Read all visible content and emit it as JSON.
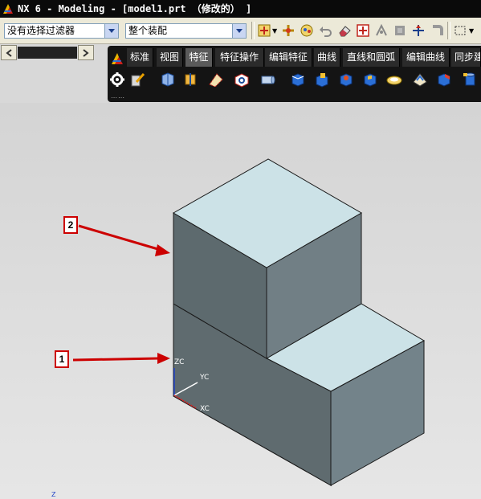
{
  "window": {
    "title": "NX 6 - Modeling - [model1.prt （修改的） ]"
  },
  "toolbar": {
    "filter_value": "没有选择过滤器",
    "scope_value": "整个装配"
  },
  "ribbon": {
    "tabs": [
      "标准",
      "视图",
      "特征",
      "特征操作",
      "编辑特征",
      "曲线",
      "直线和圆弧",
      "编辑曲线",
      "同步建"
    ],
    "active_tab": "特征"
  },
  "viewport": {
    "csys_labels": {
      "zc": "ZC",
      "yc": "YC",
      "xc": "XC"
    },
    "corner_label": "Z",
    "callouts": [
      "2",
      "1"
    ]
  },
  "colors": {
    "accent_red": "#cc0000",
    "face_top": "#cde3e8",
    "face_left": "#606c70",
    "face_right": "#74848a",
    "viewport_bg": "#dcdcdc"
  }
}
